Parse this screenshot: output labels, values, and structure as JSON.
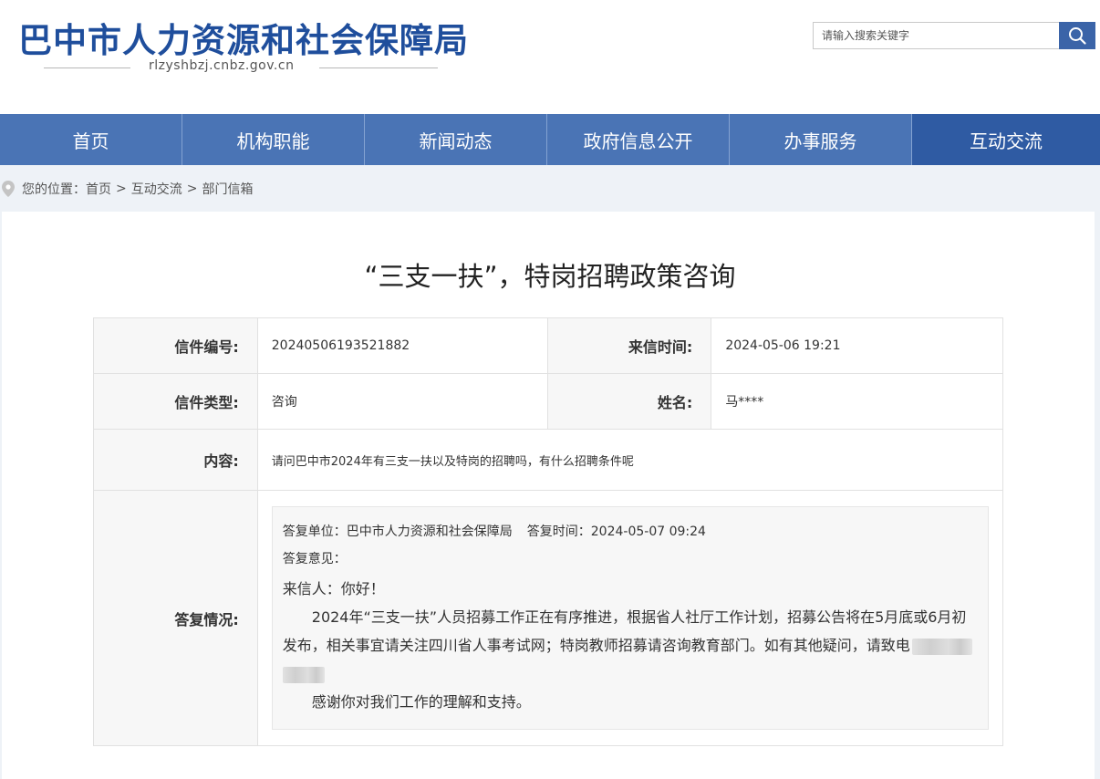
{
  "header": {
    "site_title": "巴中市人力资源和社会保障局",
    "domain": "rlzyshbzj.cnbz.gov.cn",
    "search_placeholder": "请输入搜索关键字"
  },
  "nav": {
    "items": [
      {
        "label": "首页"
      },
      {
        "label": "机构职能"
      },
      {
        "label": "新闻动态"
      },
      {
        "label": "政府信息公开"
      },
      {
        "label": "办事服务"
      },
      {
        "label": "互动交流"
      }
    ],
    "active": "互动交流"
  },
  "breadcrumb": {
    "prefix": "您的位置：",
    "items": [
      "首页",
      "互动交流",
      "部门信箱"
    ],
    "separator": ">"
  },
  "letter": {
    "title": "“三支一扶”，特岗招聘政策咨询",
    "fields": {
      "number_label": "信件编号:",
      "number_value": "20240506193521882",
      "time_label": "来信时间:",
      "time_value": "2024-05-06 19:21",
      "type_label": "信件类型:",
      "type_value": "咨询",
      "name_label": "姓名:",
      "name_value": "马****",
      "content_label": "内容:",
      "content_value": "请问巴中市2024年有三支一扶以及特岗的招聘吗，有什么招聘条件呢",
      "reply_label": "答复情况:"
    },
    "reply": {
      "unit_label": "答复单位：",
      "unit_value": "巴中市人力资源和社会保障局",
      "time_label": "答复时间：",
      "time_value": "2024-05-07 09:24",
      "opinion_label": "答复意见：",
      "greeting": "来信人：你好！",
      "para1": "2024年“三支一扶”人员招募工作正在有序推进，根据省人社厅工作计划，招募公告将在5月底或6月初发布，相关事宜请关注四川省人事考试网；特岗教师招募请咨询教育部门。如有其他疑问，请致电",
      "para2": "感谢你对我们工作的理解和支持。"
    }
  },
  "colors": {
    "brand": "#1f4e9c",
    "nav_bg": "#4a74b5",
    "nav_active": "#2f5ba3",
    "page_bg": "#eef2f7"
  }
}
